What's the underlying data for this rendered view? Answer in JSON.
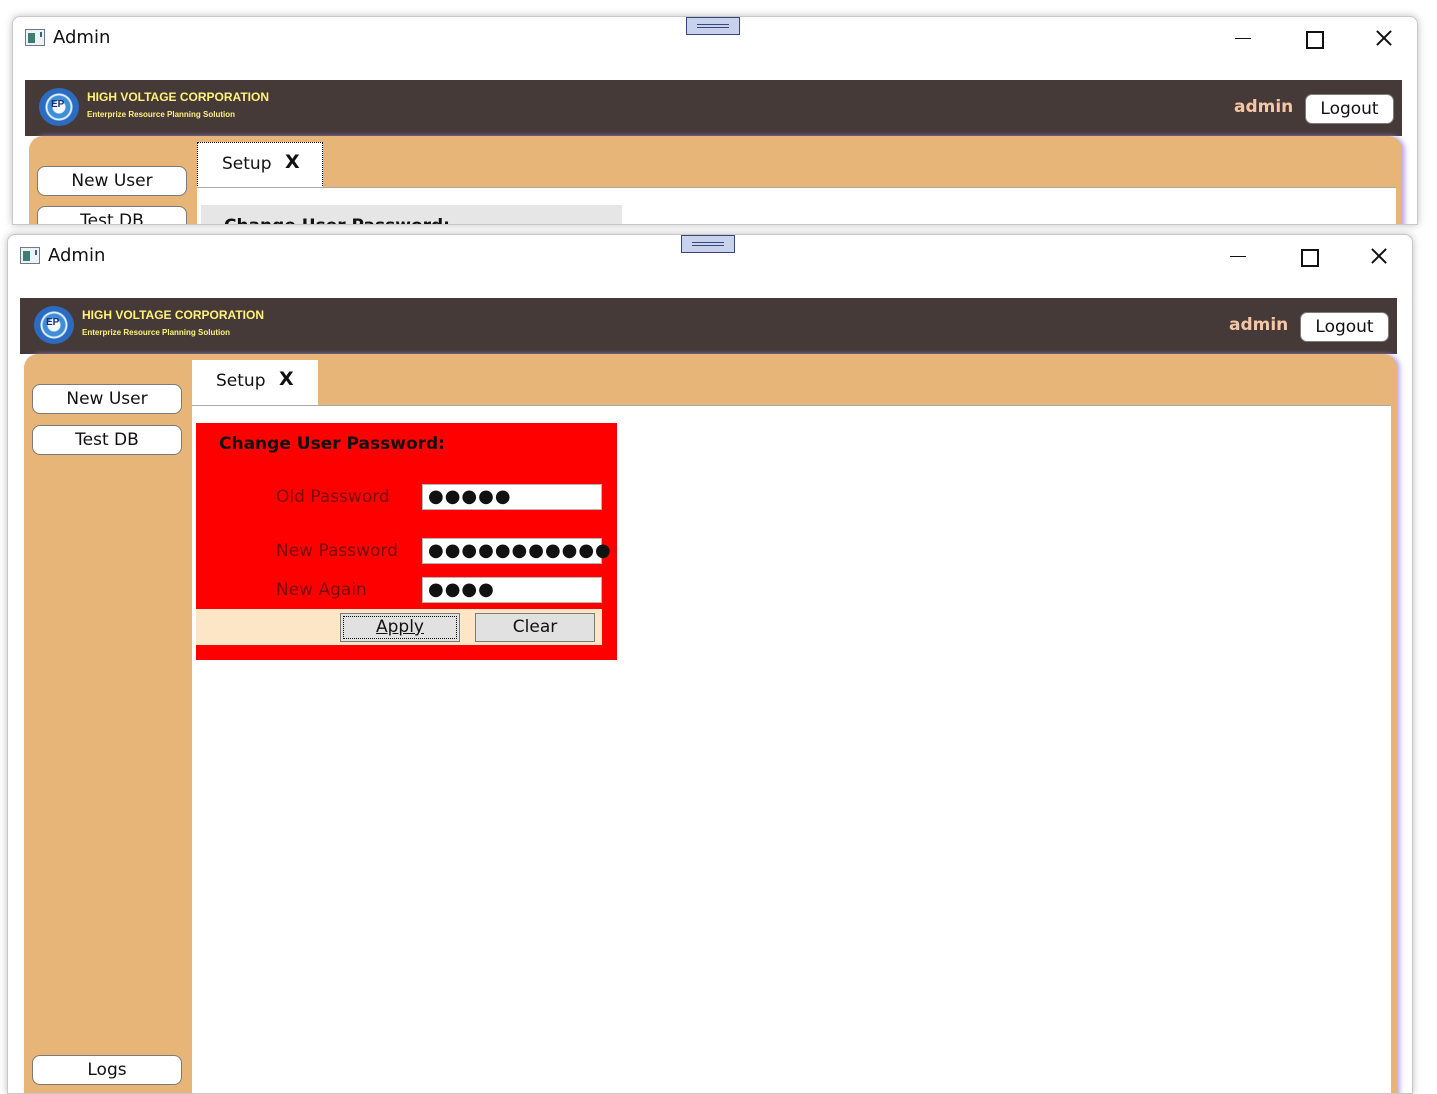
{
  "window": {
    "title": "Admin"
  },
  "header": {
    "company_name": "HIGH VOLTAGE CORPORATION",
    "company_tagline": "Enterprize Resource Planning Solution",
    "logo_text": "EP",
    "username": "admin",
    "logout_label": "Logout"
  },
  "sidebar": {
    "items": [
      {
        "label": "New User"
      },
      {
        "label": "Test DB"
      },
      {
        "label": "Logs"
      }
    ]
  },
  "tabs": [
    {
      "label": "Setup",
      "close_label": "X"
    }
  ],
  "change_password": {
    "title": "Change User Password:",
    "old_password": {
      "label": "Old Password",
      "value": "●●●●●"
    },
    "new_password": {
      "label": "New Password",
      "value": "●●●●●●●●●●●"
    },
    "new_again": {
      "label": "New Again",
      "value": "●●●●"
    },
    "apply_label": "Apply",
    "clear_label": "Clear"
  },
  "back_window_partial": {
    "sidebar_second_label": "Test DB",
    "panel_title": "Change User Password:"
  },
  "colors": {
    "header_bg": "#463a39",
    "company_text": "#fff27a",
    "username_text": "#f7c7a5",
    "body_bg": "#e6b577",
    "panel_bg": "#ff0000",
    "button_row_bg": "#fde6c6"
  },
  "icons": {
    "app": "app-window-icon",
    "minimize": "minimize-icon",
    "maximize": "maximize-icon",
    "close": "close-icon",
    "drag": "drag-grip-icon"
  }
}
